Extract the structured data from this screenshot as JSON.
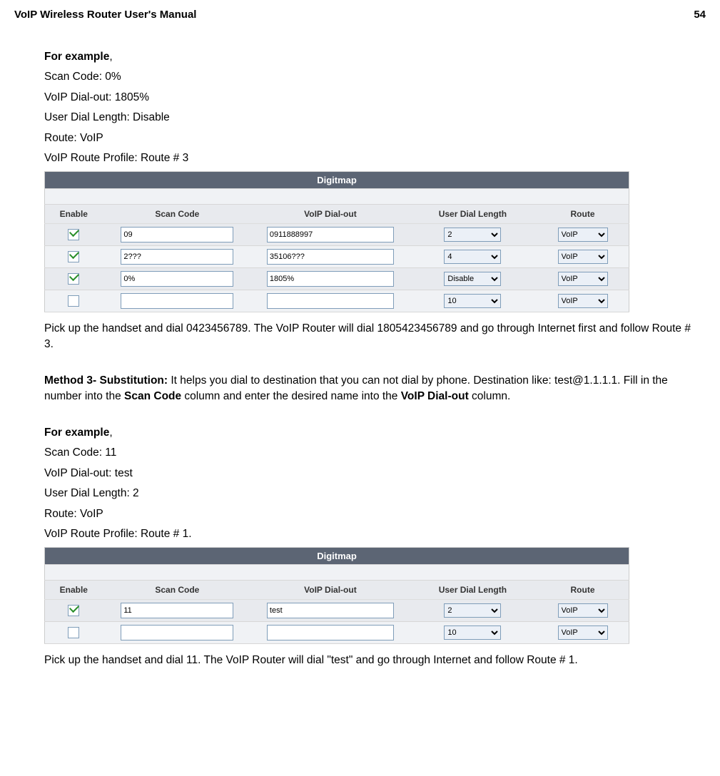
{
  "header": {
    "left": "VoIP Wireless Router User's Manual",
    "right": "54"
  },
  "ex1": {
    "title": "For example",
    "lines": [
      "Scan Code: 0%",
      "VoIP Dial-out: 1805%",
      "User Dial Length: Disable",
      "Route: VoIP",
      "VoIP Route Profile: Route # 3"
    ]
  },
  "table1": {
    "title": "Digitmap",
    "headers": [
      "Enable",
      "Scan Code",
      "VoIP Dial-out",
      "User Dial Length",
      "Route"
    ],
    "rows": [
      {
        "enable": true,
        "scan": "09",
        "dial": "0911888997",
        "len": "2",
        "route": "VoIP"
      },
      {
        "enable": true,
        "scan": "2???",
        "dial": "35106???",
        "len": "4",
        "route": "VoIP"
      },
      {
        "enable": true,
        "scan": "0%",
        "dial": "1805%",
        "len": "Disable",
        "route": "VoIP"
      },
      {
        "enable": false,
        "scan": "",
        "dial": "",
        "len": "10",
        "route": "VoIP"
      }
    ]
  },
  "para1": "Pick up the handset and dial 0423456789. The VoIP Router will dial 1805423456789 and go through Internet first and follow Route # 3.",
  "method3": {
    "label": "Method 3- Substitution:",
    "text_a": " It helps you dial to destination that you can not dial by phone. Destination like: test@1.1.1.1. Fill in the number into the ",
    "b1": "Scan Code",
    "text_b": " column and enter the desired name into the ",
    "b2": "VoIP Dial-out",
    "text_c": " column."
  },
  "ex2": {
    "title": "For example",
    "lines": [
      "Scan Code: 11",
      "VoIP Dial-out: test",
      "User Dial Length: 2",
      "Route: VoIP",
      "VoIP Route Profile: Route # 1."
    ]
  },
  "table2": {
    "title": "Digitmap",
    "headers": [
      "Enable",
      "Scan Code",
      "VoIP Dial-out",
      "User Dial Length",
      "Route"
    ],
    "rows": [
      {
        "enable": true,
        "scan": "11",
        "dial": "test",
        "len": "2",
        "route": "VoIP"
      },
      {
        "enable": false,
        "scan": "",
        "dial": "",
        "len": "10",
        "route": "VoIP"
      }
    ]
  },
  "para2": "Pick up the handset and dial 11. The VoIP Router will dial \"test\" and go through Internet and follow Route # 1."
}
